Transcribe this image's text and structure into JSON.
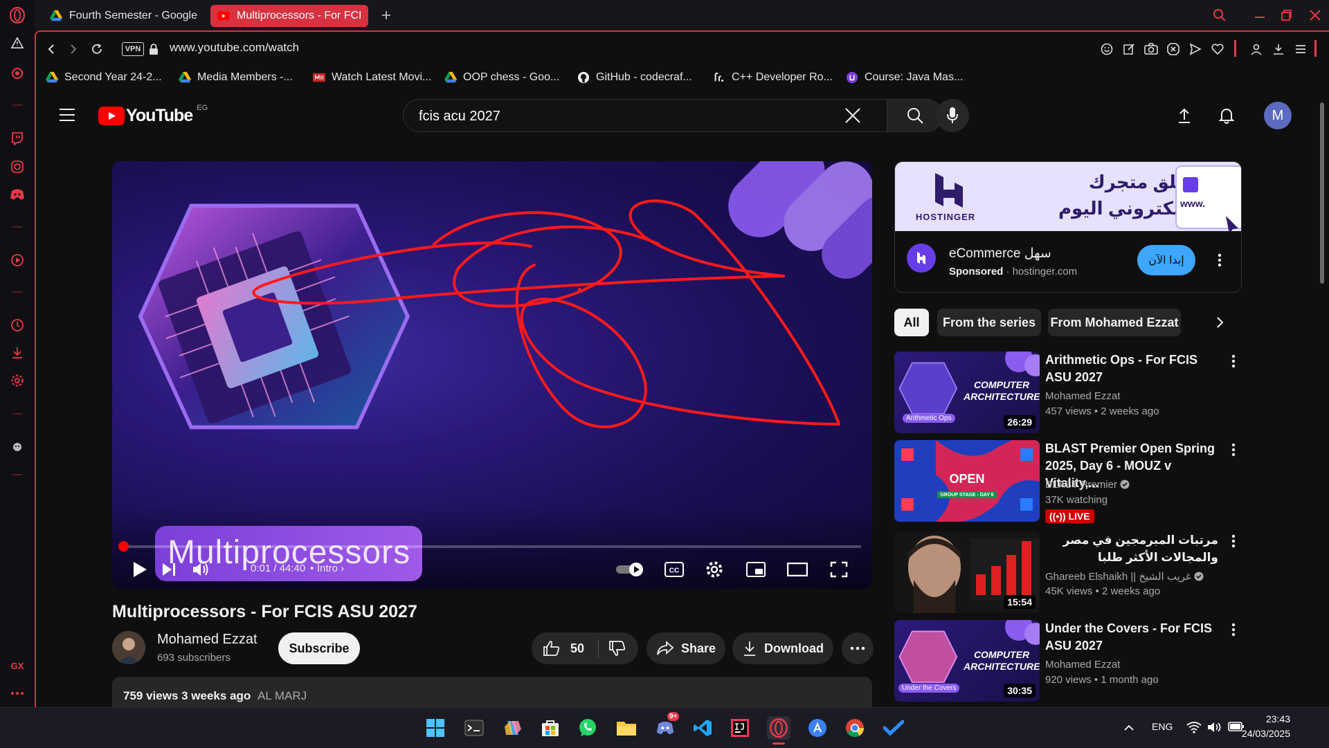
{
  "browser": {
    "tabs": [
      {
        "label": "Fourth Semester - Google"
      },
      {
        "label": "Multiprocessors - For FCI"
      }
    ],
    "url": "www.youtube.com/watch",
    "vpn_label": "VPN",
    "bookmarks": [
      {
        "label": "Second Year 24-2..."
      },
      {
        "label": "Media Members -..."
      },
      {
        "label": "Watch Latest Movi..."
      },
      {
        "label": "OOP chess - Goo..."
      },
      {
        "label": "GitHub - codecraf..."
      },
      {
        "label": "C++ Developer Ro..."
      },
      {
        "label": "Course: Java Mas..."
      }
    ],
    "sidebar_badge": "GX"
  },
  "youtube": {
    "logo_text": "YouTube",
    "country_code": "EG",
    "search": {
      "value": "fcis acu 2027"
    },
    "avatar_letter": "M"
  },
  "player": {
    "overlay_title": "Multiprocessors",
    "time": "0:01 / 44:40",
    "chapter": "Intro",
    "progress_fraction": 0.0004
  },
  "video": {
    "title": "Multiprocessors - For FCIS ASU 2027",
    "channel": "Mohamed Ezzat",
    "subscribers": "693 subscribers",
    "subscribe_label": "Subscribe",
    "likes": "50",
    "share_label": "Share",
    "download_label": "Download",
    "stats": "759 views  3 weeks ago",
    "location": "AL MARJ"
  },
  "ad": {
    "headline": "أطلق متجرك الإلكتروني اليوم",
    "brand": "HOSTINGER",
    "banner_url_text": "www.",
    "title": "eCommerce سهل",
    "sponsored": "Sponsored",
    "domain": "hostinger.com",
    "cta": "إبدا الآن"
  },
  "chips": [
    {
      "label": "All"
    },
    {
      "label": "From the series"
    },
    {
      "label": "From Mohamed Ezzat"
    }
  ],
  "recommendations": [
    {
      "title": "Arithmetic Ops - For FCIS ASU 2027",
      "channel": "Mohamed Ezzat",
      "meta": "457 views  • 2 weeks ago",
      "duration": "26:29",
      "thumb_caption": "COMPUTER ARCHITECTURE",
      "thumb_tag": "Arithmetic Ops"
    },
    {
      "title": "BLAST Premier Open Spring 2025, Day 6 - MOUZ v Vitality,...",
      "channel": "BLAST Premier",
      "meta": "37K watching",
      "live": "LIVE",
      "thumb_caption": "OPEN",
      "thumb_tag": "GROUP STAGE - DAY 6"
    },
    {
      "title": "مرتبات المبرمجين في مصر والمجالات الأكثر طلبا",
      "channel": "Ghareeb Elshaikh || غريب الشيخ",
      "meta": "45K views  • 2 weeks ago",
      "duration": "15:54"
    },
    {
      "title": "Under the Covers - For FCIS ASU 2027",
      "channel": "Mohamed Ezzat",
      "meta": "920 views  • 1 month ago",
      "duration": "30:35",
      "thumb_caption": "COMPUTER ARCHITECTURE",
      "thumb_tag": "Under the Covers"
    }
  ],
  "taskbar": {
    "language": "ENG",
    "time": "23:43",
    "date": "24/03/2025",
    "discord_badge": "9+"
  },
  "colors": {
    "opera_red": "#d6323f",
    "yt_red": "#ff0000",
    "annotation_red": "#ff1a1a",
    "ad_blue": "#3ea6ff",
    "hostinger_purple": "#673de6"
  }
}
